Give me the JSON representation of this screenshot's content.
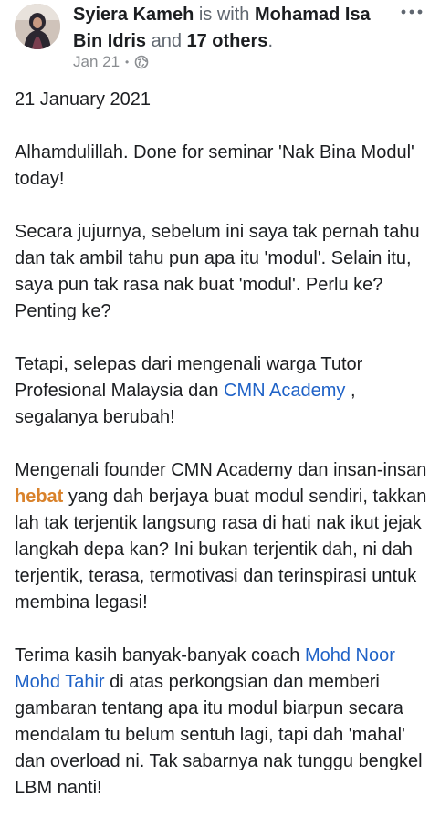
{
  "header": {
    "author": "Syiera Kameh",
    "with_text": " is with ",
    "tagged": "Mohamad Isa Bin Idris",
    "and_text": " and ",
    "others": "17 others",
    "period": ".",
    "date": "Jan 21",
    "separator": "•",
    "privacy_icon": "globe-icon",
    "more_icon": "more-dots-icon"
  },
  "post": {
    "date_line": "21 January 2021",
    "p2": "Alhamdulillah. Done for seminar 'Nak Bina Modul' today!",
    "p3": "Secara jujurnya, sebelum ini saya tak pernah tahu dan tak ambil tahu pun apa itu 'modul'. Selain itu, saya pun tak rasa nak buat 'modul'. Perlu ke? Penting ke?",
    "p4_before": "Tetapi, selepas dari  mengenali warga Tutor Profesional Malaysia dan ",
    "p4_link": "CMN Academy",
    "p4_after": " , segalanya berubah!",
    "p5_before": "Mengenali founder CMN Academy dan insan-insan ",
    "p5_highlight": "hebat",
    "p5_after": " yang dah berjaya buat modul sendiri, takkan lah tak terjentik langsung rasa di hati nak ikut jejak langkah depa kan? Ini bukan terjentik dah, ni dah terjentik, terasa, termotivasi dan terinspirasi untuk membina legasi!",
    "p6_before": "Terima kasih banyak-banyak coach ",
    "p6_link": "Mohd Noor Mohd Tahir",
    "p6_after": " di atas perkongsian dan memberi gambaran tentang apa itu modul biarpun secara mendalam tu belum sentuh lagi, tapi dah 'mahal' dan overload ni. Tak sabarnya nak tunggu bengkel LBM nanti!"
  },
  "colors": {
    "link": "#1f62c7",
    "highlight": "#d9822b",
    "muted": "#8a8d91"
  }
}
